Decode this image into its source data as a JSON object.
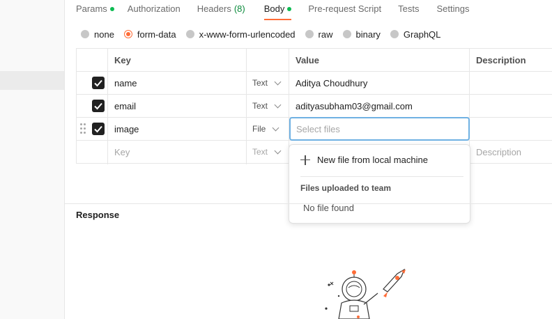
{
  "tabs": [
    {
      "label": "Params",
      "has_dot": true
    },
    {
      "label": "Authorization"
    },
    {
      "label": "Headers",
      "count": "(8)"
    },
    {
      "label": "Body",
      "has_dot": true,
      "active": true
    },
    {
      "label": "Pre-request Script"
    },
    {
      "label": "Tests"
    },
    {
      "label": "Settings"
    }
  ],
  "body_types": [
    "none",
    "form-data",
    "x-www-form-urlencoded",
    "raw",
    "binary",
    "GraphQL"
  ],
  "body_type_selected": "form-data",
  "table": {
    "headers": {
      "key": "Key",
      "value": "Value",
      "description": "Description"
    },
    "rows": [
      {
        "key": "name",
        "type": "Text",
        "value": "Aditya Choudhury",
        "checked": true
      },
      {
        "key": "email",
        "type": "Text",
        "value": "adityasubham03@gmail.com",
        "checked": true
      },
      {
        "key": "image",
        "type": "File",
        "value_placeholder": "Select files",
        "checked": true
      }
    ],
    "empty_row": {
      "key_placeholder": "Key",
      "type": "Text",
      "description_placeholder": "Description"
    }
  },
  "file_dropdown": {
    "new_file": "New file from local machine",
    "section_title": "Files uploaded to team",
    "empty_text": "No file found"
  },
  "response": {
    "title": "Response"
  },
  "colors": {
    "accent": "#ff6c37",
    "dot": "#0cbb52",
    "focus_border": "#6fb1e3"
  }
}
